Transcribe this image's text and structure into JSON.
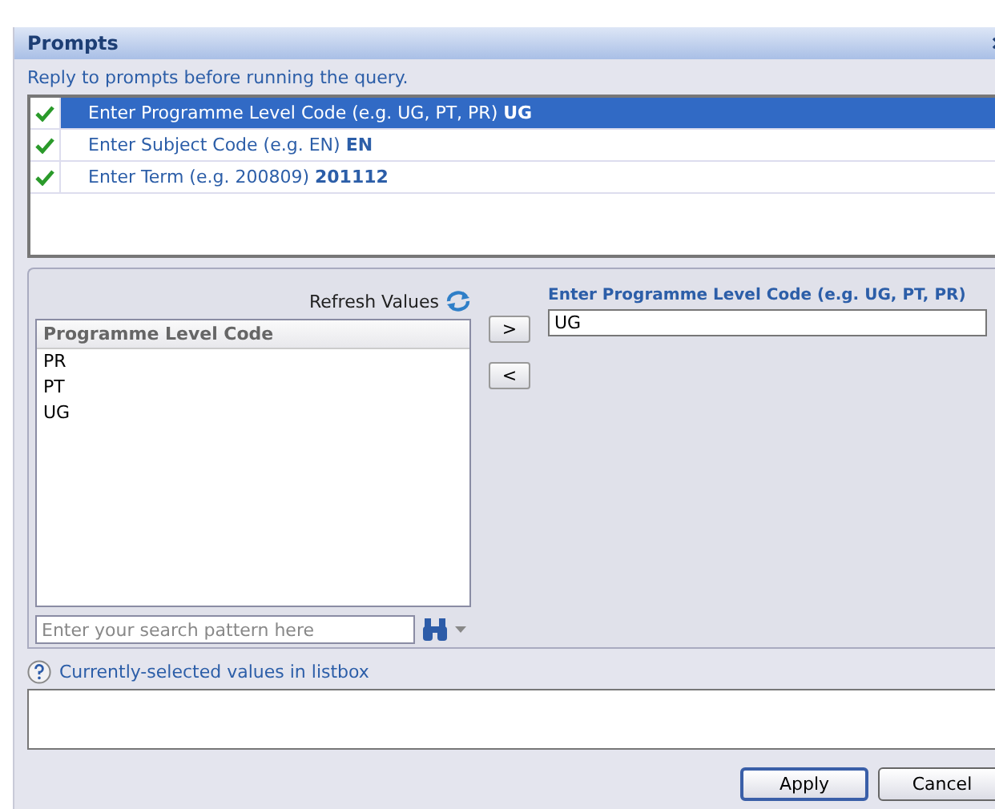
{
  "window": {
    "title": "Prompts"
  },
  "instruction": "Reply to prompts before running the query.",
  "prompts": [
    {
      "label": "Enter Programme Level Code (e.g. UG, PT, PR)",
      "value": "UG",
      "answered": true,
      "selected": true
    },
    {
      "label": "Enter Subject Code (e.g. EN)",
      "value": "EN",
      "answered": true,
      "selected": false
    },
    {
      "label": "Enter Term (e.g. 200809)",
      "value": "201112",
      "answered": true,
      "selected": false
    }
  ],
  "refresh": {
    "label": "Refresh Values"
  },
  "listbox": {
    "header": "Programme Level Code",
    "items": [
      {
        "label": "PR",
        "selected": false
      },
      {
        "label": "PT",
        "selected": false
      },
      {
        "label": "UG",
        "selected": false
      }
    ]
  },
  "add_button": ">",
  "remove_button": "<",
  "answer": {
    "label": "Enter Programme Level Code (e.g. UG, PT, PR)",
    "value": "UG"
  },
  "search": {
    "placeholder": "Enter your search pattern here"
  },
  "help": {
    "label": "Currently-selected values in listbox"
  },
  "buttons": [
    "Apply",
    "Cancel"
  ]
}
